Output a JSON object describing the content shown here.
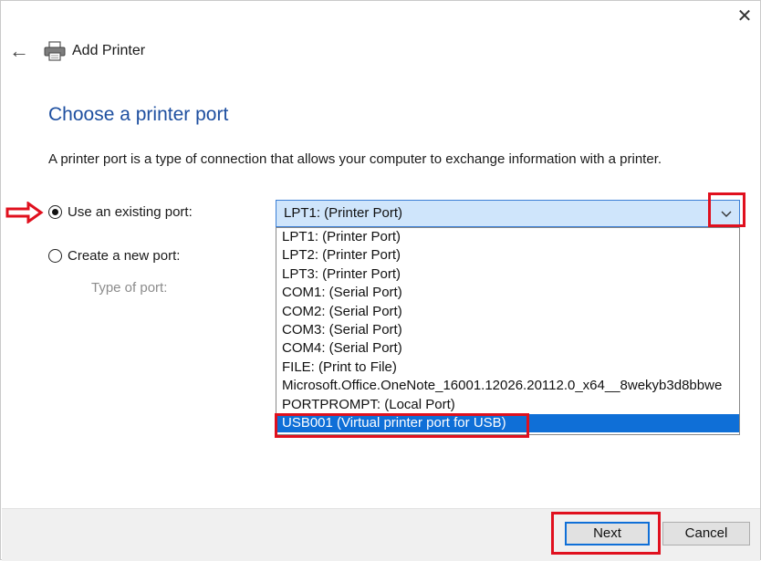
{
  "window": {
    "title": "Add Printer",
    "close_glyph": "✕",
    "back_glyph": "←"
  },
  "page": {
    "heading": "Choose a printer port",
    "description": "A printer port is a type of connection that allows your computer to exchange information with a printer."
  },
  "options": {
    "existing_label": "Use an existing port:",
    "existing_checked": true,
    "new_label": "Create a new port:",
    "new_checked": false,
    "type_label": "Type of port:"
  },
  "port_select": {
    "selected_value": "LPT1: (Printer Port)",
    "items": [
      "LPT1: (Printer Port)",
      "LPT2: (Printer Port)",
      "LPT3: (Printer Port)",
      "COM1: (Serial Port)",
      "COM2: (Serial Port)",
      "COM3: (Serial Port)",
      "COM4: (Serial Port)",
      "FILE: (Print to File)",
      "Microsoft.Office.OneNote_16001.12026.20112.0_x64__8wekyb3d8bbwe",
      "PORTPROMPT: (Local Port)",
      "USB001 (Virtual printer port for USB)"
    ],
    "highlighted_index": 10
  },
  "footer": {
    "next_label": "Next",
    "cancel_label": "Cancel"
  },
  "colors": {
    "heading": "#1e4fa0",
    "highlight": "#0f6fd7",
    "annotation": "#e0101e"
  },
  "icons": {
    "back": "arrow-left-icon",
    "printer": "printer-icon",
    "close": "close-icon",
    "dropdown": "chevron-down-icon",
    "annotation": "red-arrow-icon"
  }
}
